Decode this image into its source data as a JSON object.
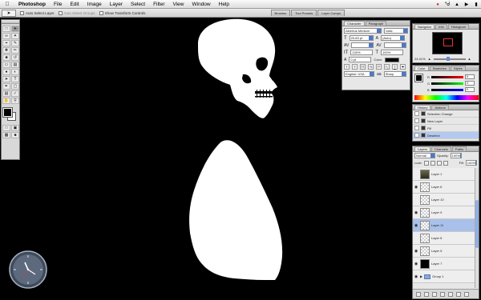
{
  "menubar": {
    "apple_icon": "apple-icon",
    "items": [
      "Photoshop",
      "File",
      "Edit",
      "Image",
      "Layer",
      "Select",
      "Filter",
      "View",
      "Window",
      "Help"
    ],
    "status_icons": [
      "flash-drive-icon",
      "bluetooth-icon",
      "wifi-icon",
      "speaker-icon",
      "battery-icon"
    ]
  },
  "options": {
    "auto_select_layer": "Auto Select Layer",
    "auto_select_groups": "Auto Select Groups",
    "show_transform_controls": "Show Transform Controls"
  },
  "palette_well": {
    "tabs": [
      "Brushes",
      "Tool Presets",
      "Layer Comps"
    ]
  },
  "character": {
    "tabs": [
      "Character",
      "Paragraph"
    ],
    "font_family": "Albertus Medium",
    "font_style": "Italic",
    "font_size": "20.83 pt",
    "leading": "(Auto)",
    "scale_v": "100%",
    "scale_h": "100%",
    "baseline": "0 pt",
    "color_label": "Color:",
    "language": "English: USA",
    "antialias": "Sharp"
  },
  "navigator": {
    "tabs": [
      "Navigator",
      "Info",
      "Histogram"
    ],
    "zoom": "24.41%"
  },
  "color_palette": {
    "tabs": [
      "Color",
      "Swatches",
      "Styles"
    ],
    "channels": [
      {
        "label": "R",
        "value": "0"
      },
      {
        "label": "G",
        "value": "0"
      },
      {
        "label": "B",
        "value": "0"
      }
    ]
  },
  "history": {
    "tabs": [
      "History",
      "Actions"
    ],
    "items": [
      "Selection Change",
      "New Layer",
      "Fill",
      "Deselect"
    ],
    "selected_index": 3
  },
  "layers": {
    "tabs": [
      "Layers",
      "Channels",
      "Paths"
    ],
    "blend_mode": "Normal",
    "opacity_label": "Opacity:",
    "opacity": "100%",
    "lock_label": "Lock:",
    "fill_label": "Fill:",
    "fill": "100%",
    "rows": [
      {
        "name": "Layer 1",
        "thumb": "photo",
        "visible": false
      },
      {
        "name": "Layer 6",
        "thumb": "transparent",
        "visible": true
      },
      {
        "name": "Layer 10",
        "thumb": "transparent",
        "visible": false
      },
      {
        "name": "Layer 9",
        "thumb": "transparent",
        "visible": true
      },
      {
        "name": "Layer 11",
        "thumb": "transparent",
        "visible": true,
        "selected": true
      },
      {
        "name": "Layer 8",
        "thumb": "transparent",
        "visible": false
      },
      {
        "name": "Layer 5",
        "thumb": "transparent",
        "visible": true
      },
      {
        "name": "Layer 7",
        "thumb": "black",
        "visible": true
      },
      {
        "name": "Group 1",
        "thumb": "folder",
        "visible": true
      }
    ]
  },
  "colors": {
    "canvas": "#000000",
    "selection": "#a9c1ea",
    "accent": "#4b79c9"
  }
}
